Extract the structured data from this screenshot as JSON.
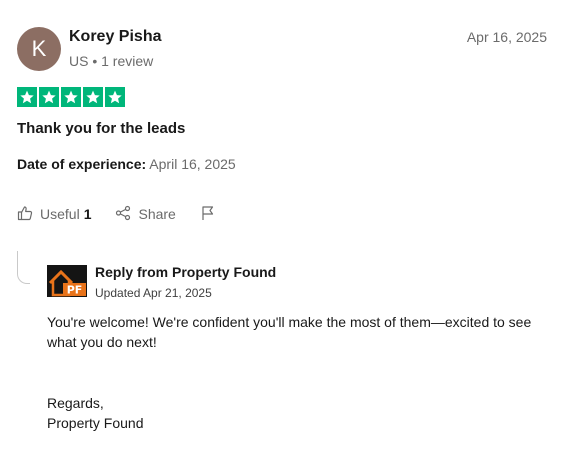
{
  "review": {
    "author": {
      "initial": "K",
      "name": "Korey Pisha",
      "meta": "US • 1 review",
      "avatar_color": "#8c6e63"
    },
    "date": "Apr 16, 2025",
    "rating": 5,
    "star_color": "#00b67a",
    "title": "Thank you for the leads",
    "experience_label": "Date of experience:",
    "experience_date": "April 16, 2025",
    "actions": {
      "useful_label": "Useful",
      "useful_count": "1",
      "share_label": "Share",
      "icons": [
        "thumbs-up-icon",
        "share-icon",
        "flag-icon"
      ]
    }
  },
  "reply": {
    "from": "Reply from Property Found",
    "updated": "Updated Apr 21, 2025",
    "logo_text": "PF",
    "logo_accent": "#e8731a",
    "body": "You're welcome! We're confident you'll make the most of them—excited to see what you do next!",
    "sign_line1": "Regards,",
    "sign_line2": "Property Found"
  }
}
